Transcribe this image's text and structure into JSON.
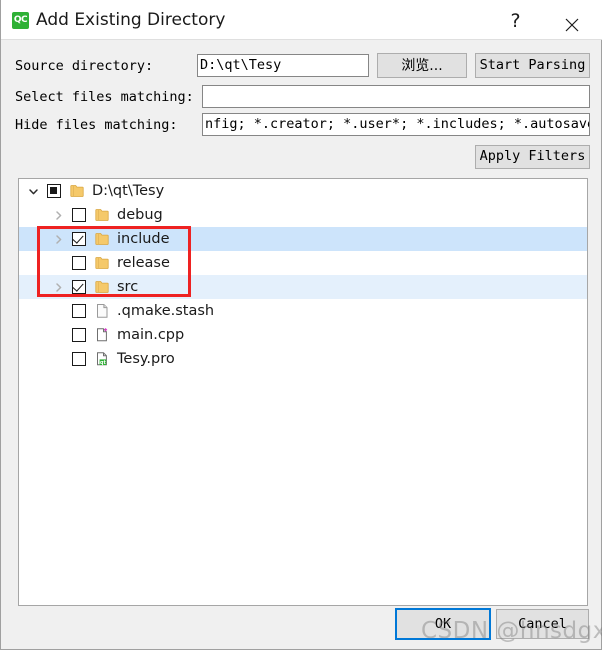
{
  "window": {
    "title": "Add Existing Directory",
    "app_icon_label": "QC",
    "help_button": "?",
    "close_button": "✕"
  },
  "form": {
    "source_directory_label": "Source directory:",
    "source_directory_value": "D:\\qt\\Tesy",
    "browse_button": "浏览...",
    "start_parsing_button": "Start Parsing",
    "select_files_label": "Select files matching:",
    "select_files_value": "",
    "select_files_placeholder": "",
    "hide_files_label": "Hide files matching:",
    "hide_files_value": "nfig; *.creator; *.user*; *.includes; *.autosave",
    "apply_filters_button": "Apply Filters"
  },
  "tree": {
    "items": [
      {
        "label": "D:\\qt\\Tesy",
        "depth": 0,
        "expander": "chevron-down",
        "check_state": "partial",
        "icon": "folder-icon",
        "row_state": "none"
      },
      {
        "label": "debug",
        "depth": 1,
        "expander": "chevron-right",
        "check_state": "unchecked",
        "icon": "folder-icon",
        "row_state": "none"
      },
      {
        "label": "include",
        "depth": 1,
        "expander": "chevron-right",
        "check_state": "checked",
        "icon": "folder-icon",
        "row_state": "selected-dark"
      },
      {
        "label": "release",
        "depth": 1,
        "expander": "none",
        "check_state": "unchecked",
        "icon": "folder-icon",
        "row_state": "none"
      },
      {
        "label": "src",
        "depth": 1,
        "expander": "chevron-right",
        "check_state": "checked",
        "icon": "folder-icon",
        "row_state": "selected-light"
      },
      {
        "label": ".qmake.stash",
        "depth": 1,
        "expander": "none",
        "check_state": "unchecked",
        "icon": "file-plain-icon",
        "row_state": "none"
      },
      {
        "label": "main.cpp",
        "depth": 1,
        "expander": "none",
        "check_state": "unchecked",
        "icon": "file-cpp-icon",
        "row_state": "none"
      },
      {
        "label": "Tesy.pro",
        "depth": 1,
        "expander": "none",
        "check_state": "unchecked",
        "icon": "file-qt-pro-icon",
        "row_state": "none"
      }
    ]
  },
  "footer": {
    "ok_button": "OK",
    "cancel_button": "Cancel"
  },
  "watermark": {
    "text": "CSDN @hnsdgxylh"
  },
  "colors": {
    "accent_focus": "#0078d7",
    "selection_dark": "#cde4fb",
    "selection_light": "#e4f0fc",
    "annotation": "#ee2222",
    "app_icon_green": "#2eb135",
    "dialog_background": "#f0f0f0"
  }
}
